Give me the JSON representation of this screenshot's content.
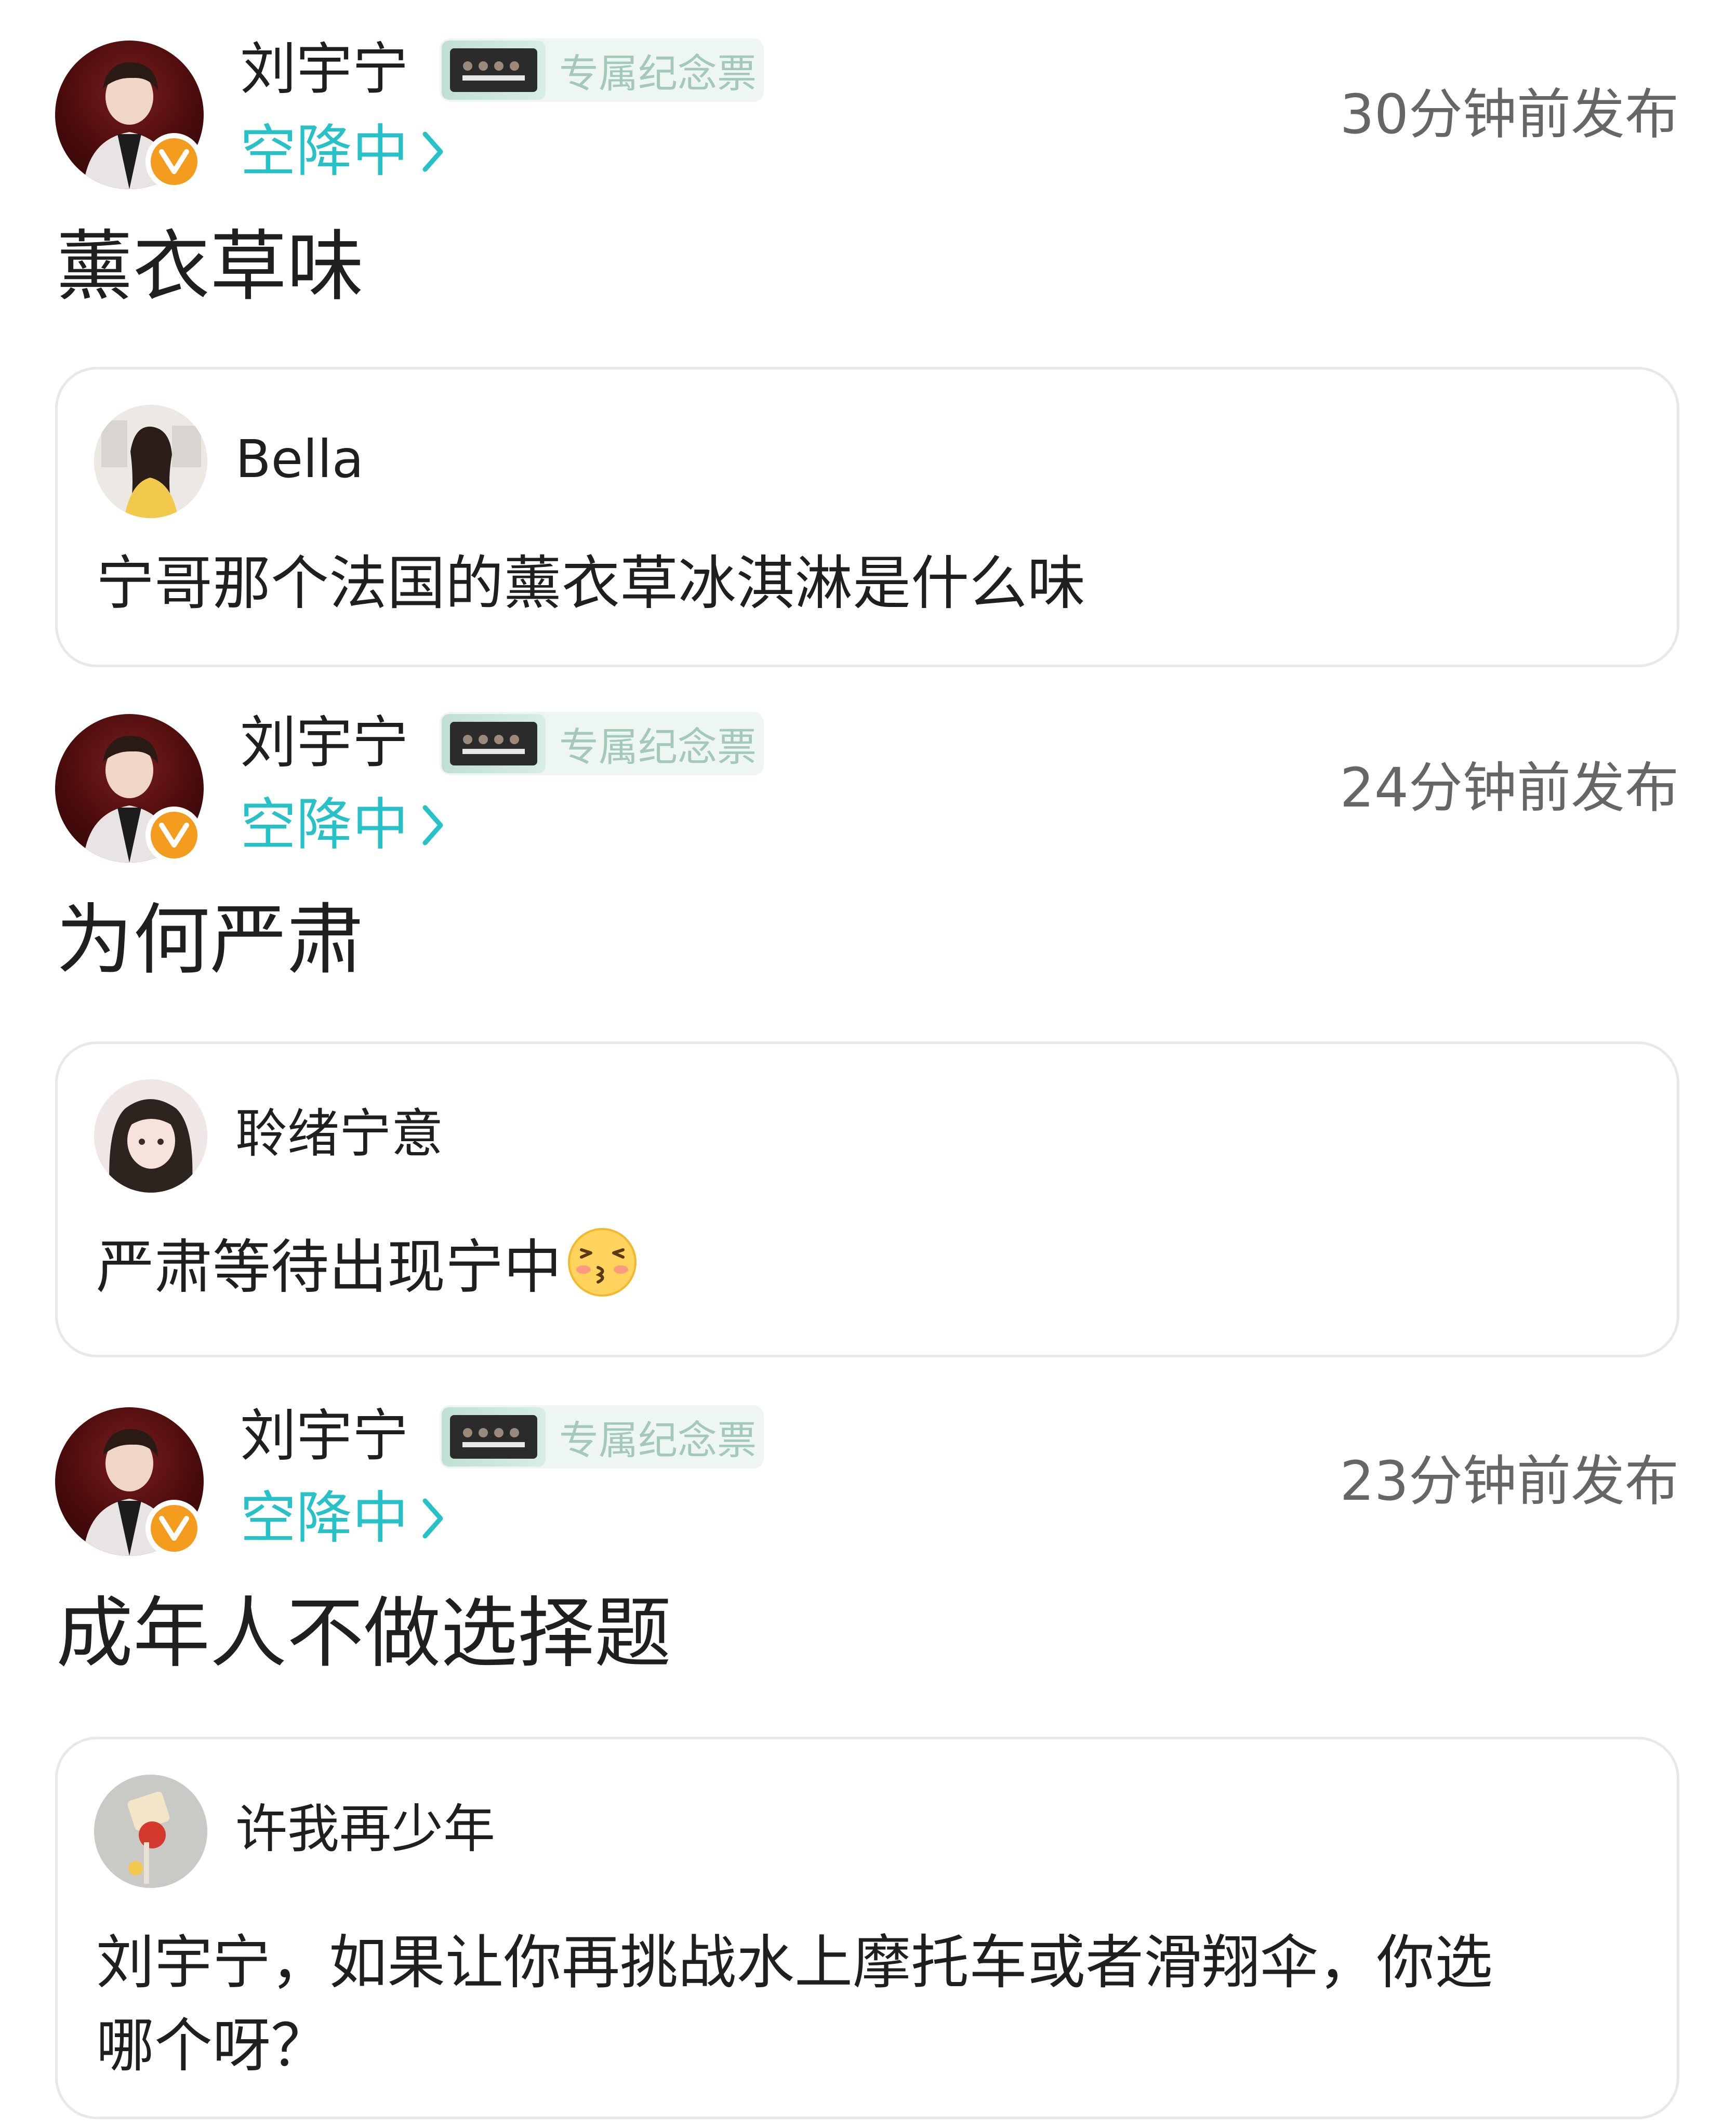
{
  "author": {
    "name": "刘宇宁",
    "ticket_label": "专属纪念票",
    "status": "空降中"
  },
  "posts": [
    {
      "time": "30分钟前发布",
      "text": "薰衣草味",
      "reply": {
        "name": "Bella",
        "text": "宁哥那个法国的薰衣草冰淇淋是什么味"
      }
    },
    {
      "time": "24分钟前发布",
      "text": "为何严肃",
      "reply": {
        "name": "聆绪宁意",
        "text": "严肃等待出现宁中"
      }
    },
    {
      "time": "23分钟前发布",
      "text": "成年人不做选择题",
      "reply": {
        "name": "许我再少年",
        "text_line1": "刘宇宁，如果让你再挑战水上摩托车或者滑翔伞，你选",
        "text_line2": "哪个呀？"
      }
    }
  ],
  "colors": {
    "accent": "#27c2c8",
    "verified": "#f39c1d",
    "time": "#666666",
    "card_border": "#e8e8e8",
    "ticket_text": "#a3c9b8"
  }
}
